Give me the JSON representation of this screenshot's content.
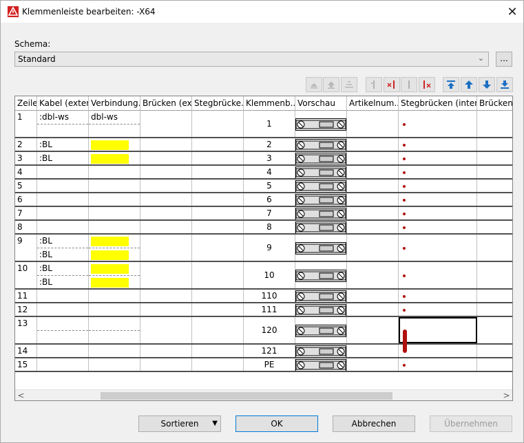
{
  "window": {
    "title": "Klemmenleiste bearbeiten: -X64",
    "icon": "eplan-logo-icon",
    "close_glyph": "✕"
  },
  "schema": {
    "label": "Schema:",
    "value": "Standard",
    "more_label": "..."
  },
  "toolbar": {
    "icons": [
      "move-top-disabled-icon",
      "move-up-disabled-icon",
      "move-bottom-disabled-icon",
      "bridge-add-icon",
      "bridge-remove-icon",
      "bridge-add-2-icon",
      "bridge-remove-2-icon",
      "arrow-top-icon",
      "arrow-up-icon",
      "arrow-down-icon",
      "arrow-bottom-icon"
    ]
  },
  "table": {
    "headers": [
      "Zeile",
      "Kabel (exter...",
      "Verbindung...",
      "Brücken (ex...",
      "Stegbrücke...",
      "Klemmenb...",
      "Vorschau",
      "Artikelnum...",
      "Stegbrücken (intern)",
      "Brücken"
    ],
    "rows": [
      {
        "zeile": "1",
        "kabel": [
          ":dbl-ws",
          ""
        ],
        "verbindung": [
          "dbl-ws",
          ""
        ],
        "yellow": [
          false,
          false
        ],
        "nummer": "1",
        "tall": true
      },
      {
        "zeile": "2",
        "kabel": [
          ":BL"
        ],
        "verbindung": [
          ""
        ],
        "yellow": [
          true
        ],
        "nummer": "2",
        "tall": false
      },
      {
        "zeile": "3",
        "kabel": [
          ":BL"
        ],
        "verbindung": [
          ""
        ],
        "yellow": [
          true
        ],
        "nummer": "3",
        "tall": false
      },
      {
        "zeile": "4",
        "kabel": [
          ""
        ],
        "verbindung": [
          ""
        ],
        "yellow": [
          false
        ],
        "nummer": "4",
        "tall": false
      },
      {
        "zeile": "5",
        "kabel": [
          ""
        ],
        "verbindung": [
          ""
        ],
        "yellow": [
          false
        ],
        "nummer": "5",
        "tall": false
      },
      {
        "zeile": "6",
        "kabel": [
          ""
        ],
        "verbindung": [
          ""
        ],
        "yellow": [
          false
        ],
        "nummer": "6",
        "tall": false
      },
      {
        "zeile": "7",
        "kabel": [
          ""
        ],
        "verbindung": [
          ""
        ],
        "yellow": [
          false
        ],
        "nummer": "7",
        "tall": false
      },
      {
        "zeile": "8",
        "kabel": [
          ""
        ],
        "verbindung": [
          ""
        ],
        "yellow": [
          false
        ],
        "nummer": "8",
        "tall": false
      },
      {
        "zeile": "9",
        "kabel": [
          ":BL",
          ":BL"
        ],
        "verbindung": [
          "",
          ""
        ],
        "yellow": [
          true,
          true
        ],
        "nummer": "9",
        "tall": true
      },
      {
        "zeile": "10",
        "kabel": [
          ":BL",
          ":BL"
        ],
        "verbindung": [
          "",
          ""
        ],
        "yellow": [
          true,
          true
        ],
        "nummer": "10",
        "tall": true
      },
      {
        "zeile": "11",
        "kabel": [
          ""
        ],
        "verbindung": [
          ""
        ],
        "yellow": [
          false
        ],
        "nummer": "110",
        "tall": false
      },
      {
        "zeile": "12",
        "kabel": [
          ""
        ],
        "verbindung": [
          ""
        ],
        "yellow": [
          false
        ],
        "nummer": "111",
        "tall": false
      },
      {
        "zeile": "13",
        "kabel": [
          "",
          ""
        ],
        "verbindung": [
          "",
          ""
        ],
        "yellow": [
          false,
          false
        ],
        "nummer": "120",
        "tall": true
      },
      {
        "zeile": "14",
        "kabel": [
          ""
        ],
        "verbindung": [
          ""
        ],
        "yellow": [
          false
        ],
        "nummer": "121",
        "tall": false
      },
      {
        "zeile": "15",
        "kabel": [
          ""
        ],
        "verbindung": [
          ""
        ],
        "yellow": [
          false
        ],
        "nummer": "PE",
        "tall": false
      }
    ],
    "selected_row": "13",
    "selected_column": "Stegbrücken (intern)"
  },
  "scrollbar": {
    "left_glyph": "<",
    "right_glyph": ">"
  },
  "buttons": {
    "sort": "Sortieren",
    "sort_arrow": "▼",
    "ok": "OK",
    "cancel": "Abbrechen",
    "apply": "Übernehmen"
  },
  "colors": {
    "highlight_yellow": "#ffff00",
    "bridge_red": "#b01010",
    "toolbar_blue": "#1a6fc4",
    "toolbar_red": "#d02020"
  }
}
